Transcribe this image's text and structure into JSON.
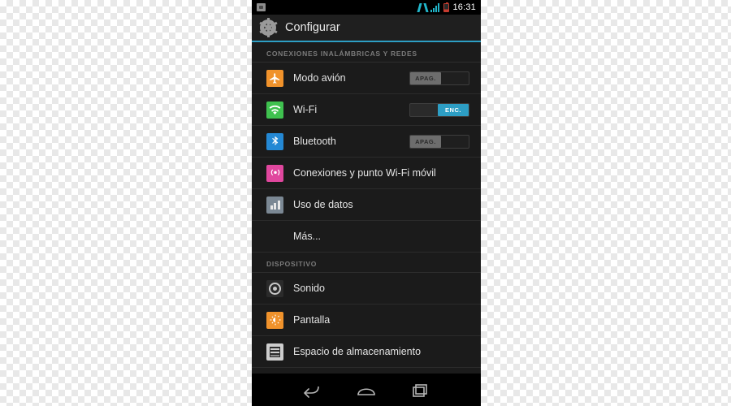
{
  "status_bar": {
    "icons": [
      "screenshot-icon",
      "sync-icon",
      "signal-icon",
      "battery-icon"
    ],
    "clock": "16:31"
  },
  "action_bar": {
    "icon": "settings-gear-icon",
    "title": "Configurar"
  },
  "sections": [
    {
      "header": "CONEXIONES INALÁMBRICAS Y REDES",
      "rows": [
        {
          "icon": "airplane-mode-icon",
          "label": "Modo avión",
          "toggle": {
            "state": "off",
            "text": "APAG."
          }
        },
        {
          "icon": "wifi-icon",
          "label": "Wi-Fi",
          "toggle": {
            "state": "on",
            "text": "ENC."
          }
        },
        {
          "icon": "bluetooth-icon",
          "label": "Bluetooth",
          "toggle": {
            "state": "off",
            "text": "APAG."
          }
        },
        {
          "icon": "hotspot-icon",
          "label": "Conexiones y punto Wi-Fi móvil",
          "toggle": null
        },
        {
          "icon": "data-usage-icon",
          "label": "Uso de datos",
          "toggle": null
        },
        {
          "icon": "none",
          "label": "Más...",
          "toggle": null
        }
      ]
    },
    {
      "header": "DISPOSITIVO",
      "rows": [
        {
          "icon": "sound-icon",
          "label": "Sonido",
          "toggle": null
        },
        {
          "icon": "display-icon",
          "label": "Pantalla",
          "toggle": null
        },
        {
          "icon": "storage-icon",
          "label": "Espacio de almacenamiento",
          "toggle": null
        }
      ]
    }
  ],
  "nav_bar": {
    "back": "back-nav-icon",
    "home": "home-nav-icon",
    "recents": "recents-nav-icon"
  },
  "colors": {
    "accent": "#2d9ec4",
    "screen_bg": "#1b1b1b",
    "orange": "#f0922b",
    "green": "#3fc14f",
    "blue": "#2488d4",
    "pink": "#e0479e"
  }
}
